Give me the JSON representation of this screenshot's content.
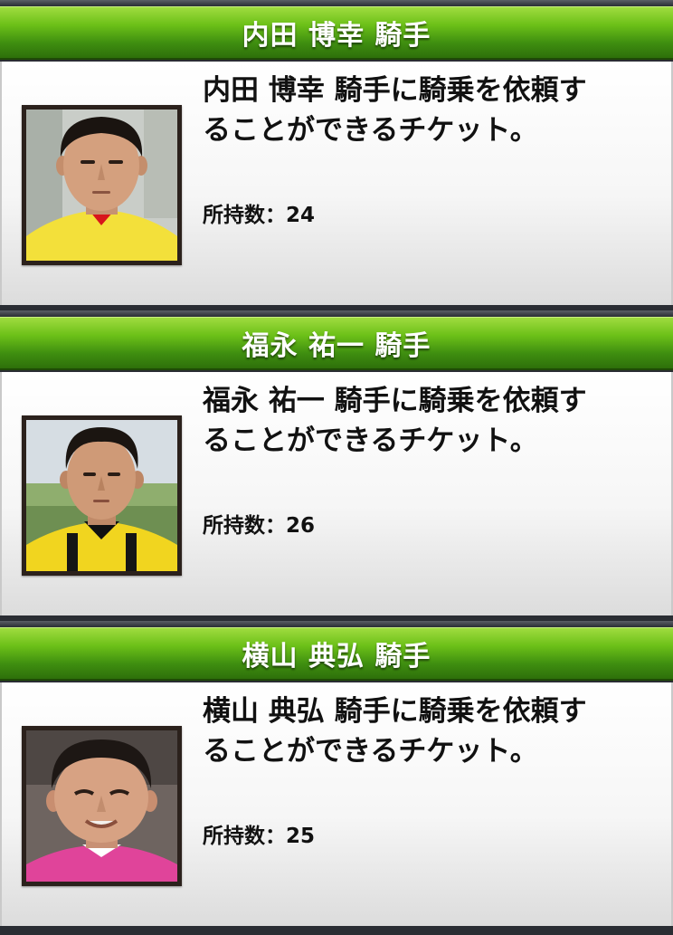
{
  "jockeys": [
    {
      "name": "内田 博幸 騎手",
      "description_line1": "内田 博幸 騎手に騎乗を依頼す",
      "description_line2": "ることができるチケット。",
      "count_label": "所持数：",
      "count": "24",
      "photo": "jockey-portrait-yellow-silks",
      "colors": {
        "silk": "#f3e03a",
        "collar": "#d8161c",
        "background": "#c9cdc8"
      }
    },
    {
      "name": "福永 祐一 騎手",
      "description_line1": "福永 祐一 騎手に騎乗を依頼す",
      "description_line2": "ることができるチケット。",
      "count_label": "所持数：",
      "count": "26",
      "photo": "jockey-portrait-yellow-black-silks",
      "colors": {
        "silk": "#f1d51f",
        "collar": "#111111",
        "background": "#8fae6e"
      }
    },
    {
      "name": "横山 典弘 騎手",
      "description_line1": "横山 典弘 騎手に騎乗を依頼す",
      "description_line2": "ることができるチケット。",
      "count_label": "所持数：",
      "count": "25",
      "photo": "jockey-portrait-pink-silks",
      "colors": {
        "silk": "#e0449a",
        "collar": "#ffffff",
        "background": "#6e6460"
      }
    }
  ],
  "theme": {
    "header_green": "#5cb31a",
    "page_background": "#2a2d33"
  }
}
